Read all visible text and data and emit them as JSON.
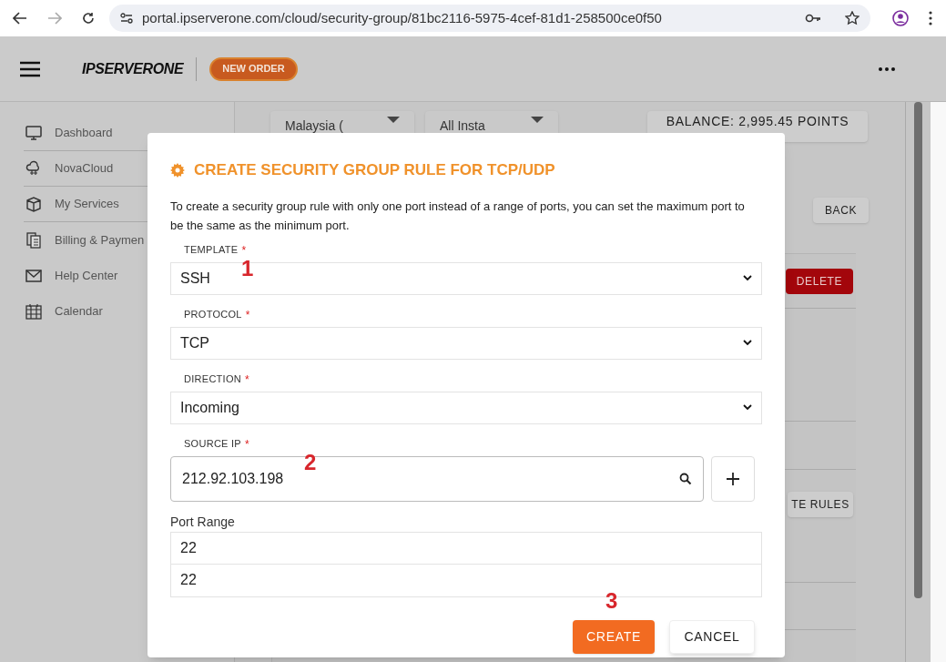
{
  "browser": {
    "url": "portal.ipserverone.com/cloud/security-group/81bc2116-5975-4cef-81d1-258500ce0f50"
  },
  "header": {
    "logo": "IPSERVERONE",
    "new_order": "NEW ORDER"
  },
  "sidebar": {
    "items": [
      {
        "label": "Dashboard"
      },
      {
        "label": "NovaCloud"
      },
      {
        "label": "My Services"
      },
      {
        "label": "Billing & Paymen"
      },
      {
        "label": "Help Center"
      },
      {
        "label": "Calendar"
      }
    ]
  },
  "content": {
    "region_select": "Malaysia (",
    "instance_select": "All Insta",
    "balance": "BALANCE: 2,995.45 POINTS",
    "back": "BACK",
    "delete": "DELETE",
    "rules_button": "TE RULES"
  },
  "dialog": {
    "title": "CREATE SECURITY GROUP RULE FOR TCP/UDP",
    "description": "To create a security group rule with only one port instead of a range of ports, you can set the maximum port to be the same as the minimum port.",
    "fields": [
      {
        "label": "TEMPLATE",
        "required_mark": "*",
        "kind": "select",
        "value": "SSH"
      },
      {
        "label": "PROTOCOL",
        "required_mark": "*",
        "kind": "select",
        "value": "TCP"
      },
      {
        "label": "DIRECTION",
        "required_mark": "*",
        "kind": "select",
        "value": "Incoming"
      },
      {
        "label": "SOURCE IP",
        "required_mark": "*",
        "kind": "search",
        "value": "212.92.103.198"
      }
    ],
    "port_range": {
      "label": "Port Range",
      "min": "22",
      "max": "22"
    },
    "buttons": [
      "CREATE",
      "CANCEL"
    ]
  },
  "annotations": [
    "1",
    "2",
    "3"
  ]
}
